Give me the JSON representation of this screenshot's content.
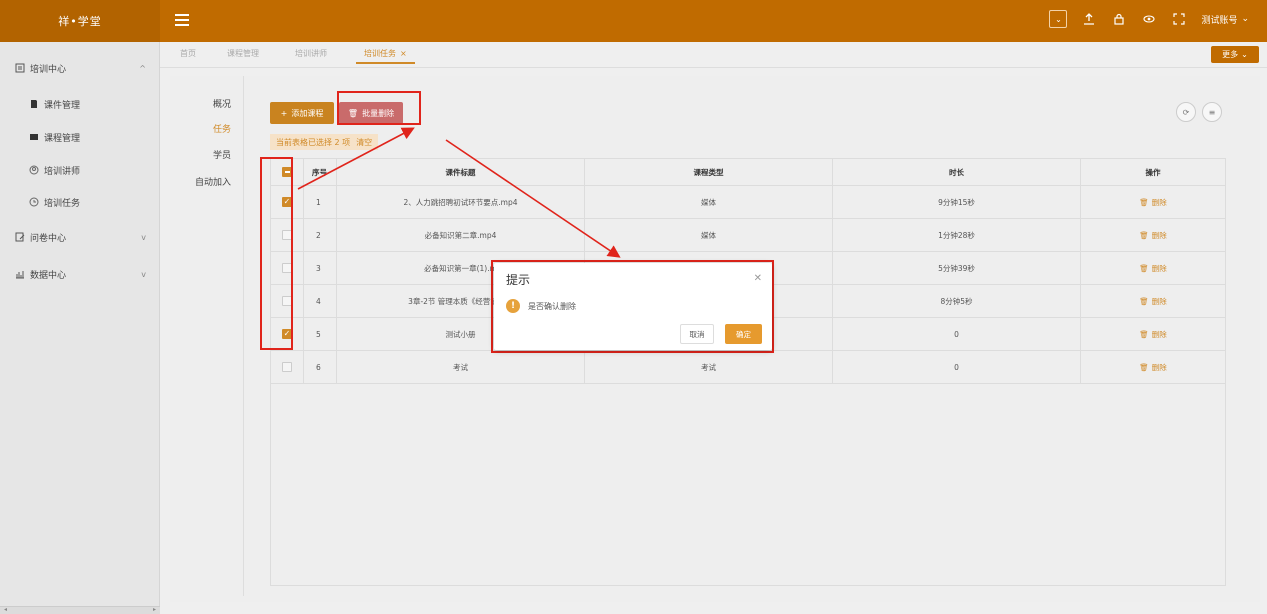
{
  "header": {
    "logo": "祥•学堂",
    "username": "测试账号",
    "icons": [
      "window-icon",
      "upload-icon",
      "lock-icon",
      "eye-icon",
      "fullscreen-icon"
    ]
  },
  "sidebar": {
    "items": [
      {
        "label": "培训中心",
        "icon": "document-icon",
        "chevron": "^"
      },
      {
        "label": "课件管理",
        "icon": "file-icon"
      },
      {
        "label": "课程管理",
        "icon": "book-icon"
      },
      {
        "label": "培训讲师",
        "icon": "person-icon"
      },
      {
        "label": "培训任务",
        "icon": "clock-icon"
      },
      {
        "label": "问卷中心",
        "icon": "edit-icon",
        "chevron": "v"
      },
      {
        "label": "数据中心",
        "icon": "chart-icon",
        "chevron": "v"
      }
    ]
  },
  "tabs": {
    "items": [
      "首页",
      "课程管理",
      "培训讲师",
      "培训任务"
    ],
    "close": "×",
    "more": "更多"
  },
  "subnav": [
    "概况",
    "任务",
    "学员",
    "自动加入"
  ],
  "toolbar": {
    "add_label": "添加课程",
    "batch_delete_label": "批量删除",
    "selected_text": "当前表格已选择 2 项",
    "clear_label": "清空"
  },
  "table": {
    "headers": [
      "序号",
      "课件标题",
      "课程类型",
      "时长",
      "操作"
    ],
    "rows": [
      {
        "checked": true,
        "idx": "1",
        "title": "2、人力跳招聘初试环节要点.mp4",
        "type": "媒体",
        "duration": "9分钟15秒",
        "op": "删除"
      },
      {
        "checked": false,
        "idx": "2",
        "title": "必备知识第二章.mp4",
        "type": "媒体",
        "duration": "1分钟28秒",
        "op": "删除"
      },
      {
        "checked": false,
        "idx": "3",
        "title": "必备知识第一章(1).m",
        "type": "",
        "duration": "5分钟39秒",
        "op": "删除"
      },
      {
        "checked": false,
        "idx": "4",
        "title": "3章-2节 管理本质《经营管理实",
        "type": "",
        "duration": "8分钟5秒",
        "op": "删除"
      },
      {
        "checked": true,
        "idx": "5",
        "title": "测试小册",
        "type": "",
        "duration": "0",
        "op": "删除"
      },
      {
        "checked": false,
        "idx": "6",
        "title": "考试",
        "type": "考试",
        "duration": "0",
        "op": "删除"
      }
    ]
  },
  "dialog": {
    "title": "提示",
    "message": "是否确认删除",
    "cancel": "取消",
    "confirm": "确定"
  },
  "colors": {
    "brand": "#c06b00",
    "accent": "#d08a28",
    "annotation": "#e0241b"
  }
}
